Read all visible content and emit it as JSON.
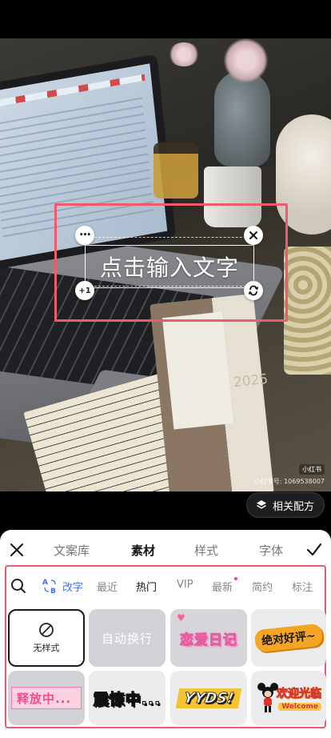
{
  "canvas": {
    "overlay_text": "点击输入文字",
    "handle_more": "•••",
    "handle_plus": "+1",
    "watermark_badge": "小红书",
    "watermark_id": "小红书号: 1069538007",
    "planner_year": "2025"
  },
  "recipe_button": {
    "label": "相关配方",
    "icon": "layers-icon"
  },
  "tabs": {
    "close_icon": "close-icon",
    "confirm_icon": "check-icon",
    "items": [
      {
        "label": "文案库",
        "active": false
      },
      {
        "label": "素材",
        "active": true
      },
      {
        "label": "样式",
        "active": false
      },
      {
        "label": "字体",
        "active": false
      }
    ]
  },
  "categories": {
    "search_icon": "search-icon",
    "ab_icon": "ab-transform-icon",
    "items": [
      {
        "label": "改字",
        "style": "blue"
      },
      {
        "label": "最近",
        "style": "normal"
      },
      {
        "label": "热门",
        "style": "active"
      },
      {
        "label": "VIP",
        "style": "normal"
      },
      {
        "label": "最新",
        "style": "normal",
        "dot": true
      },
      {
        "label": "简约",
        "style": "normal"
      },
      {
        "label": "标注",
        "style": "normal"
      }
    ]
  },
  "styles": {
    "row1": [
      {
        "label": "无样式",
        "type": "none",
        "selected": true
      },
      {
        "label": "自动换行",
        "type": "gray"
      },
      {
        "label": "恋爱日记",
        "type": "love"
      },
      {
        "label": "绝对好评~",
        "type": "praise"
      }
    ],
    "row2": [
      {
        "label": "释放中...",
        "type": "release"
      },
      {
        "label": "震惊中...",
        "type": "shock"
      },
      {
        "label": "YYDS!",
        "type": "yyds"
      },
      {
        "label": "欢迎光临",
        "sub": "Welcome",
        "type": "welcome"
      }
    ]
  },
  "colors": {
    "accent_highlight": "#f05a6e",
    "tab_active": "#111111",
    "category_blue": "#3f6fe6"
  }
}
